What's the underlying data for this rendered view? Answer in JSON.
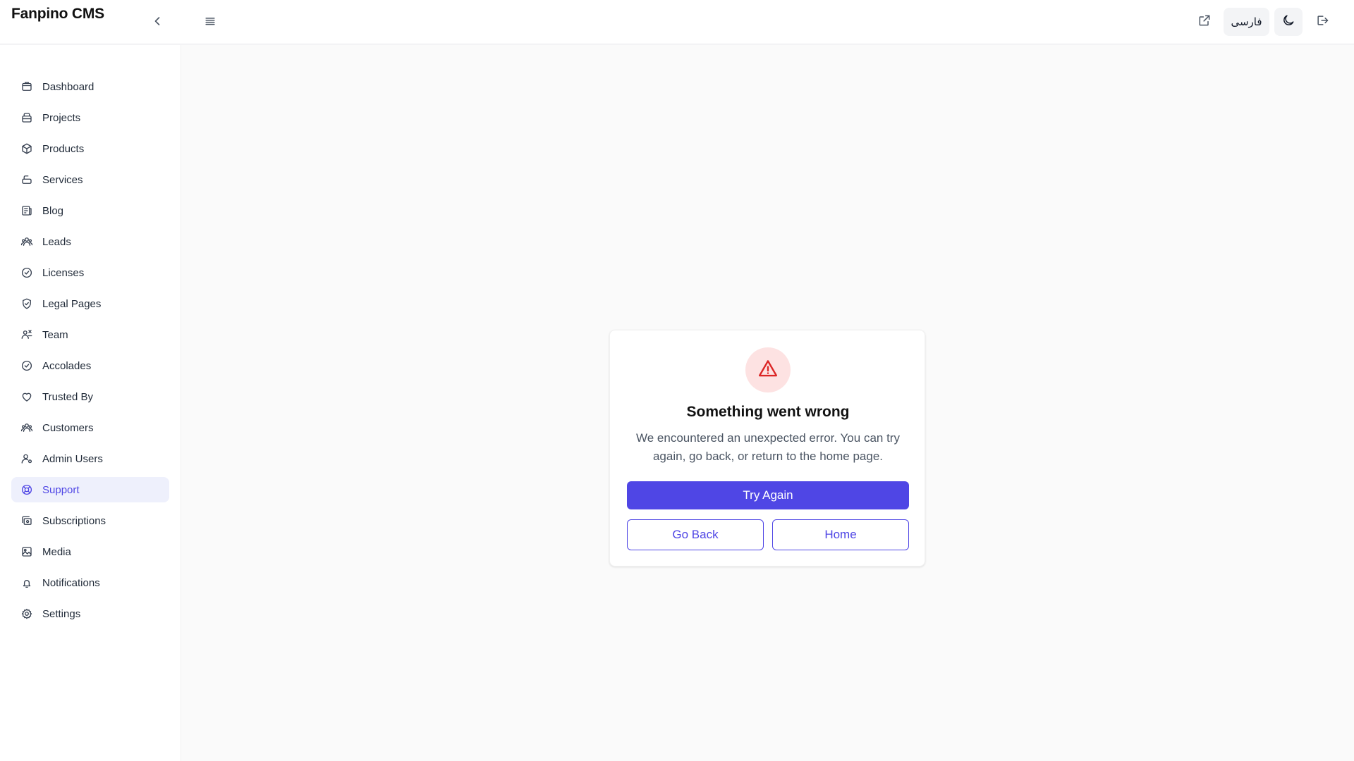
{
  "app": {
    "title": "Fanpino CMS"
  },
  "header": {
    "collapse_icon": "chevron-left-icon",
    "menu_icon": "menu-icon",
    "external_link_icon": "external-link-icon",
    "language_label": "فارسی",
    "theme_icon": "moon-icon",
    "logout_icon": "logout-icon"
  },
  "sidebar": {
    "items": [
      {
        "label": "Dashboard",
        "icon": "dashboard-icon",
        "active": false
      },
      {
        "label": "Projects",
        "icon": "projects-icon",
        "active": false
      },
      {
        "label": "Products",
        "icon": "box-icon",
        "active": false
      },
      {
        "label": "Services",
        "icon": "services-icon",
        "active": false
      },
      {
        "label": "Blog",
        "icon": "newspaper-icon",
        "active": false
      },
      {
        "label": "Leads",
        "icon": "users-icon",
        "active": false
      },
      {
        "label": "Licenses",
        "icon": "check-circle-icon",
        "active": false
      },
      {
        "label": "Legal Pages",
        "icon": "shield-check-icon",
        "active": false
      },
      {
        "label": "Team",
        "icon": "team-icon",
        "active": false
      },
      {
        "label": "Accolades",
        "icon": "badge-check-icon",
        "active": false
      },
      {
        "label": "Trusted By",
        "icon": "heart-icon",
        "active": false
      },
      {
        "label": "Customers",
        "icon": "users-icon",
        "active": false
      },
      {
        "label": "Admin Users",
        "icon": "admin-user-icon",
        "active": false
      },
      {
        "label": "Support",
        "icon": "lifebuoy-icon",
        "active": true
      },
      {
        "label": "Subscriptions",
        "icon": "subscriptions-icon",
        "active": false
      },
      {
        "label": "Media",
        "icon": "image-icon",
        "active": false
      },
      {
        "label": "Notifications",
        "icon": "bell-icon",
        "active": false
      },
      {
        "label": "Settings",
        "icon": "gear-icon",
        "active": false
      }
    ]
  },
  "error_card": {
    "icon": "warning-triangle-icon",
    "title": "Something went wrong",
    "message": "We encountered an unexpected error. You can try again, go back, or return to the home page.",
    "try_again_label": "Try Again",
    "go_back_label": "Go Back",
    "home_label": "Home"
  },
  "colors": {
    "accent": "#4f46e5",
    "danger": "#dc2626",
    "danger_bg": "#fde2e2",
    "active_nav_bg": "#eef0fc"
  }
}
